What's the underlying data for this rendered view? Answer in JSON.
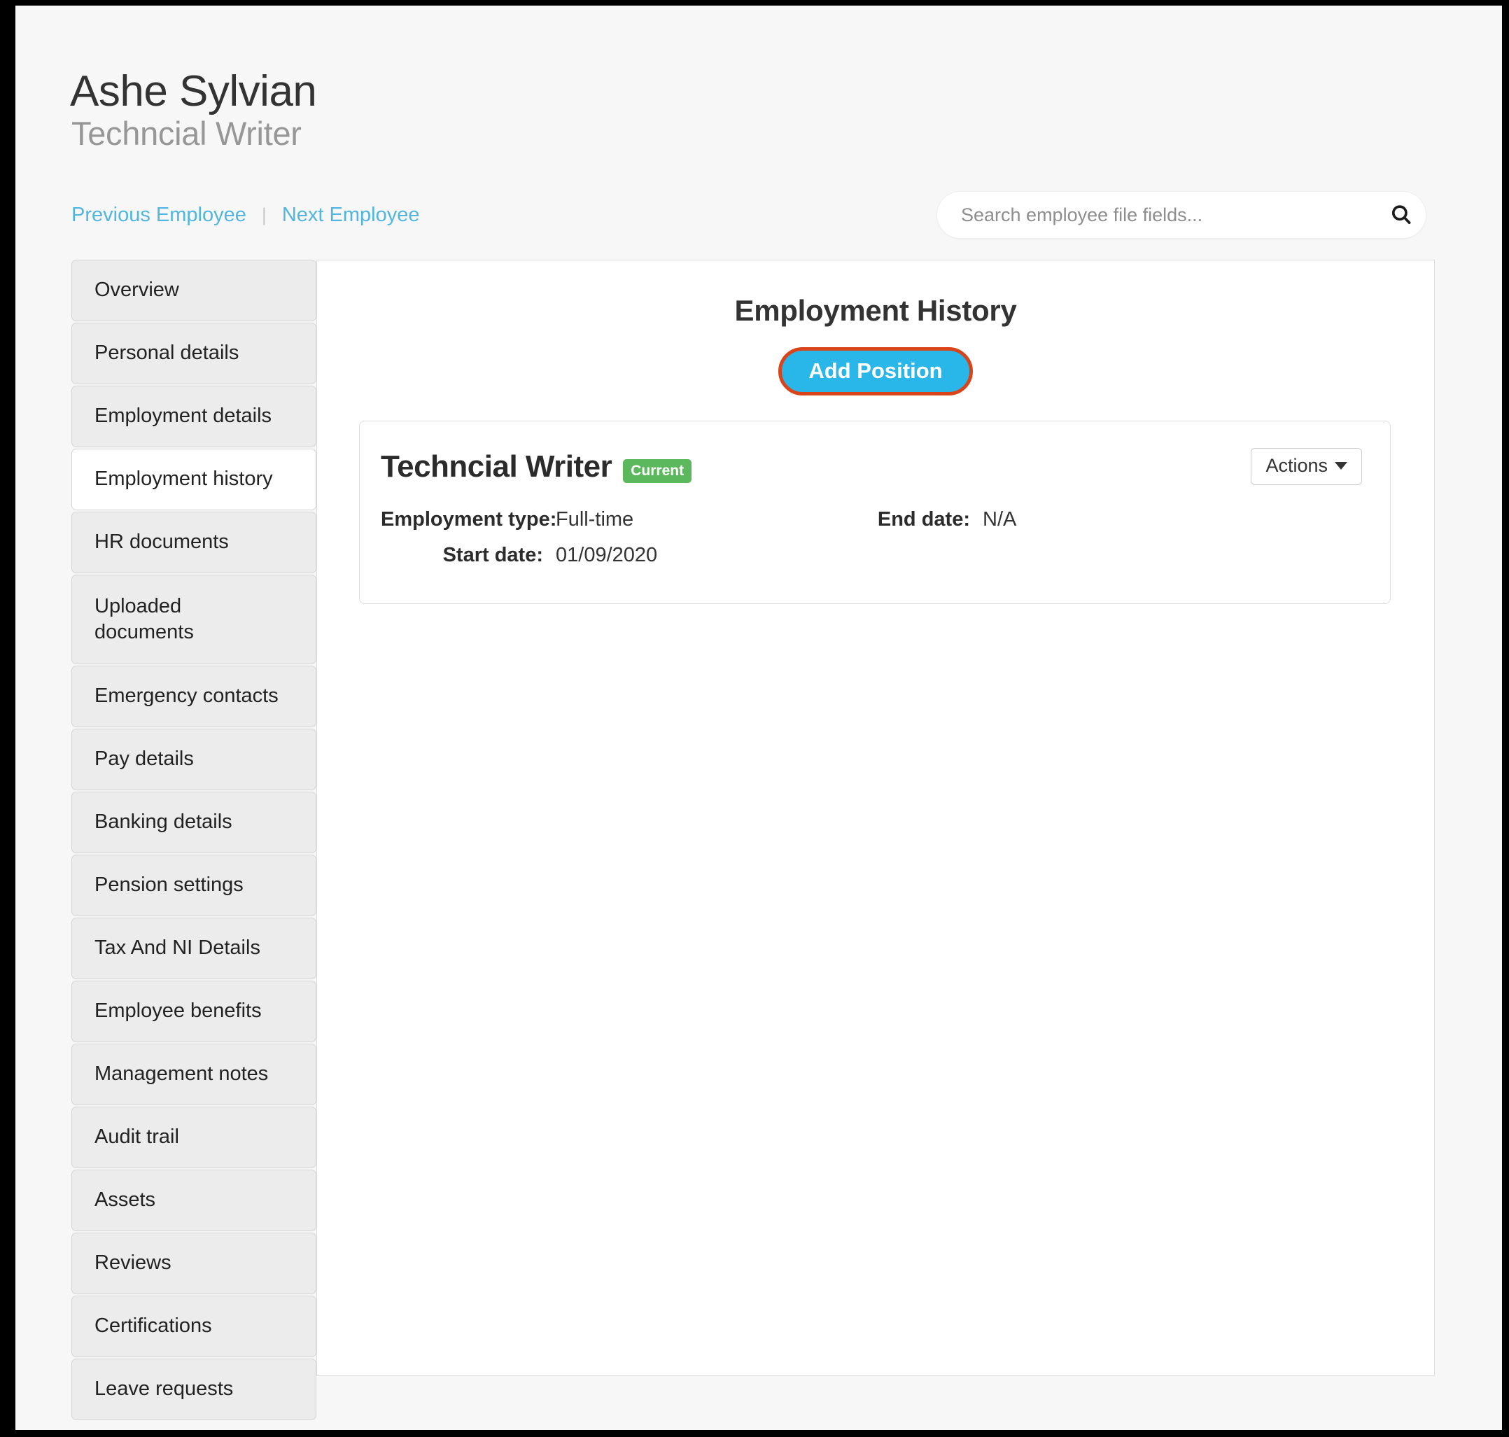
{
  "header": {
    "employee_name": "Ashe Sylvian",
    "employee_role": "Techncial Writer",
    "prev_link": "Previous Employee",
    "separator": "|",
    "next_link": "Next Employee",
    "search_placeholder": "Search employee file fields...",
    "search_value": "",
    "search_icon": "search-icon"
  },
  "sidebar": {
    "items": [
      {
        "label": "Overview",
        "active": false
      },
      {
        "label": "Personal details",
        "active": false
      },
      {
        "label": "Employment details",
        "active": false
      },
      {
        "label": "Employment history",
        "active": true
      },
      {
        "label": "HR documents",
        "active": false
      },
      {
        "label": "Uploaded documents",
        "active": false
      },
      {
        "label": "Emergency contacts",
        "active": false
      },
      {
        "label": "Pay details",
        "active": false
      },
      {
        "label": "Banking details",
        "active": false
      },
      {
        "label": "Pension settings",
        "active": false
      },
      {
        "label": "Tax And NI Details",
        "active": false
      },
      {
        "label": "Employee benefits",
        "active": false
      },
      {
        "label": "Management notes",
        "active": false
      },
      {
        "label": "Audit trail",
        "active": false
      },
      {
        "label": "Assets",
        "active": false
      },
      {
        "label": "Reviews",
        "active": false
      },
      {
        "label": "Certifications",
        "active": false
      },
      {
        "label": "Leave requests",
        "active": false
      }
    ]
  },
  "main": {
    "title": "Employment History",
    "add_position_label": "Add Position",
    "positions": [
      {
        "title": "Techncial Writer",
        "badge": "Current",
        "actions_label": "Actions",
        "employment_type_label": "Employment type:",
        "employment_type_value": "Full-time",
        "end_date_label": "End date:",
        "end_date_value": "N/A",
        "start_date_label": "Start date:",
        "start_date_value": "01/09/2020"
      }
    ]
  },
  "colors": {
    "accent_cyan": "#29b6e8",
    "highlight_ring": "#d9441a",
    "badge_green": "#5cb85c",
    "link_blue": "#51b7e0",
    "page_background": "#f7f7f7"
  }
}
